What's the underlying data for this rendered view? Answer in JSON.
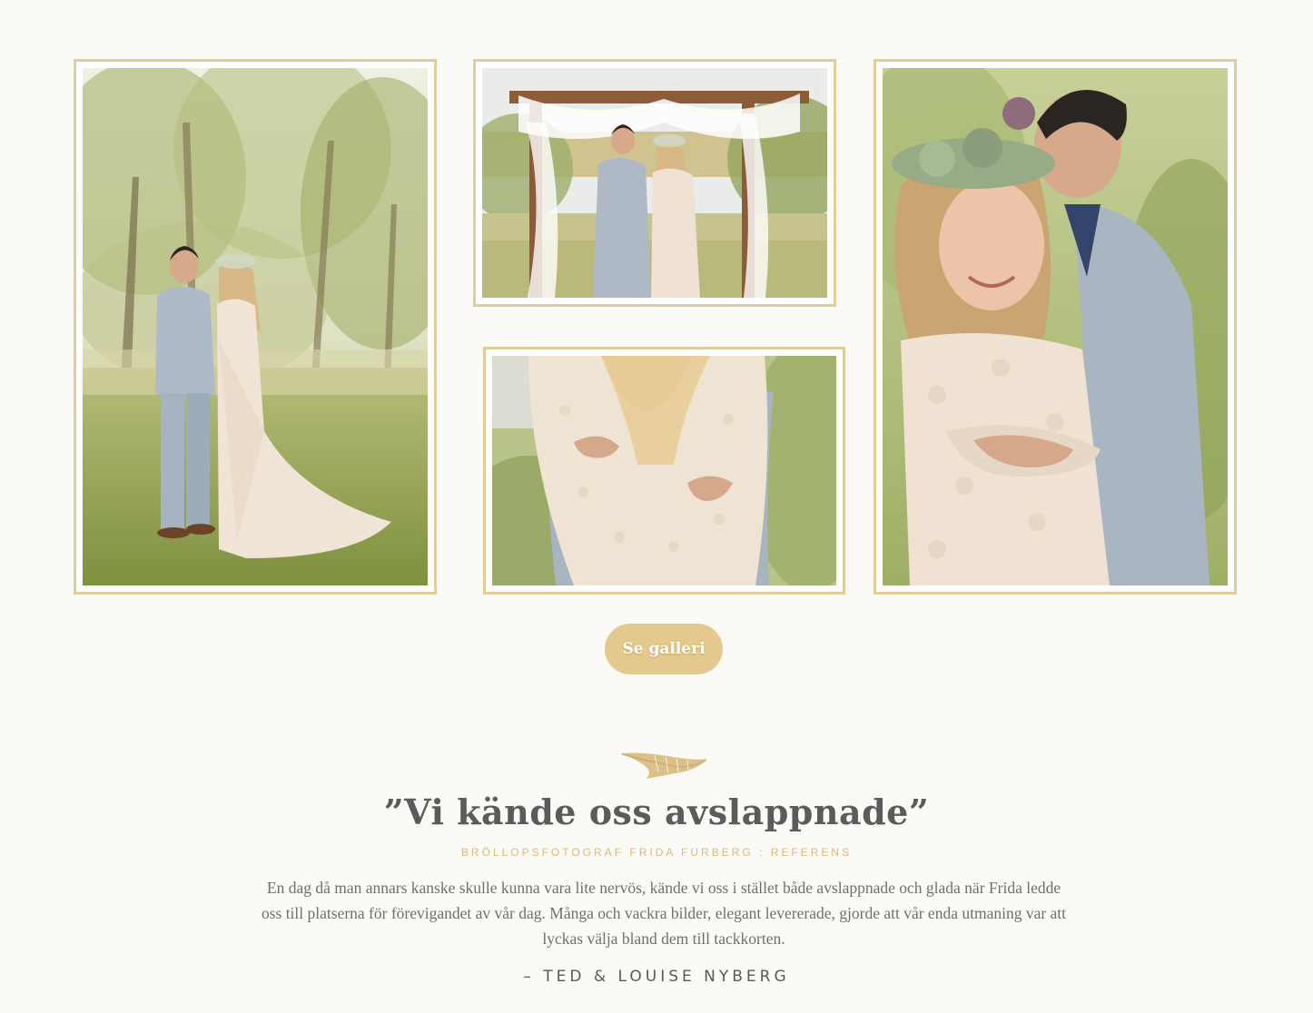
{
  "gallery": {
    "button_label": "Se galleri",
    "photos": [
      {
        "name": "photo-couple-trees"
      },
      {
        "name": "photo-couple-arch"
      },
      {
        "name": "photo-dress-back"
      },
      {
        "name": "photo-couple-embrace"
      }
    ]
  },
  "testimonial": {
    "icon": "feather-icon",
    "title": "”Vi kände oss avslappnade”",
    "subtitle": "BRÖLLOPSFOTOGRAF FRIDA FURBERG : REFERENS",
    "body": "En dag då man annars kanske skulle kunna vara lite nervös, kände vi oss i stället både avslappnade och glada när Frida ledde oss till platserna för förevigandet av vår dag. Många och vackra bilder, elegant levererade, gjorde att vår enda utmaning var att lyckas välja bland dem till tackkorten.",
    "author": "– TED & LOUISE NYBERG"
  },
  "colors": {
    "background": "#fbfaf6",
    "frame_gold": "#e3cc98",
    "button_gold": "#e3c98d",
    "subtitle_gold": "#d9ba7c",
    "title_gray": "#5b5b5b",
    "body_gray": "#6f6f6f"
  }
}
